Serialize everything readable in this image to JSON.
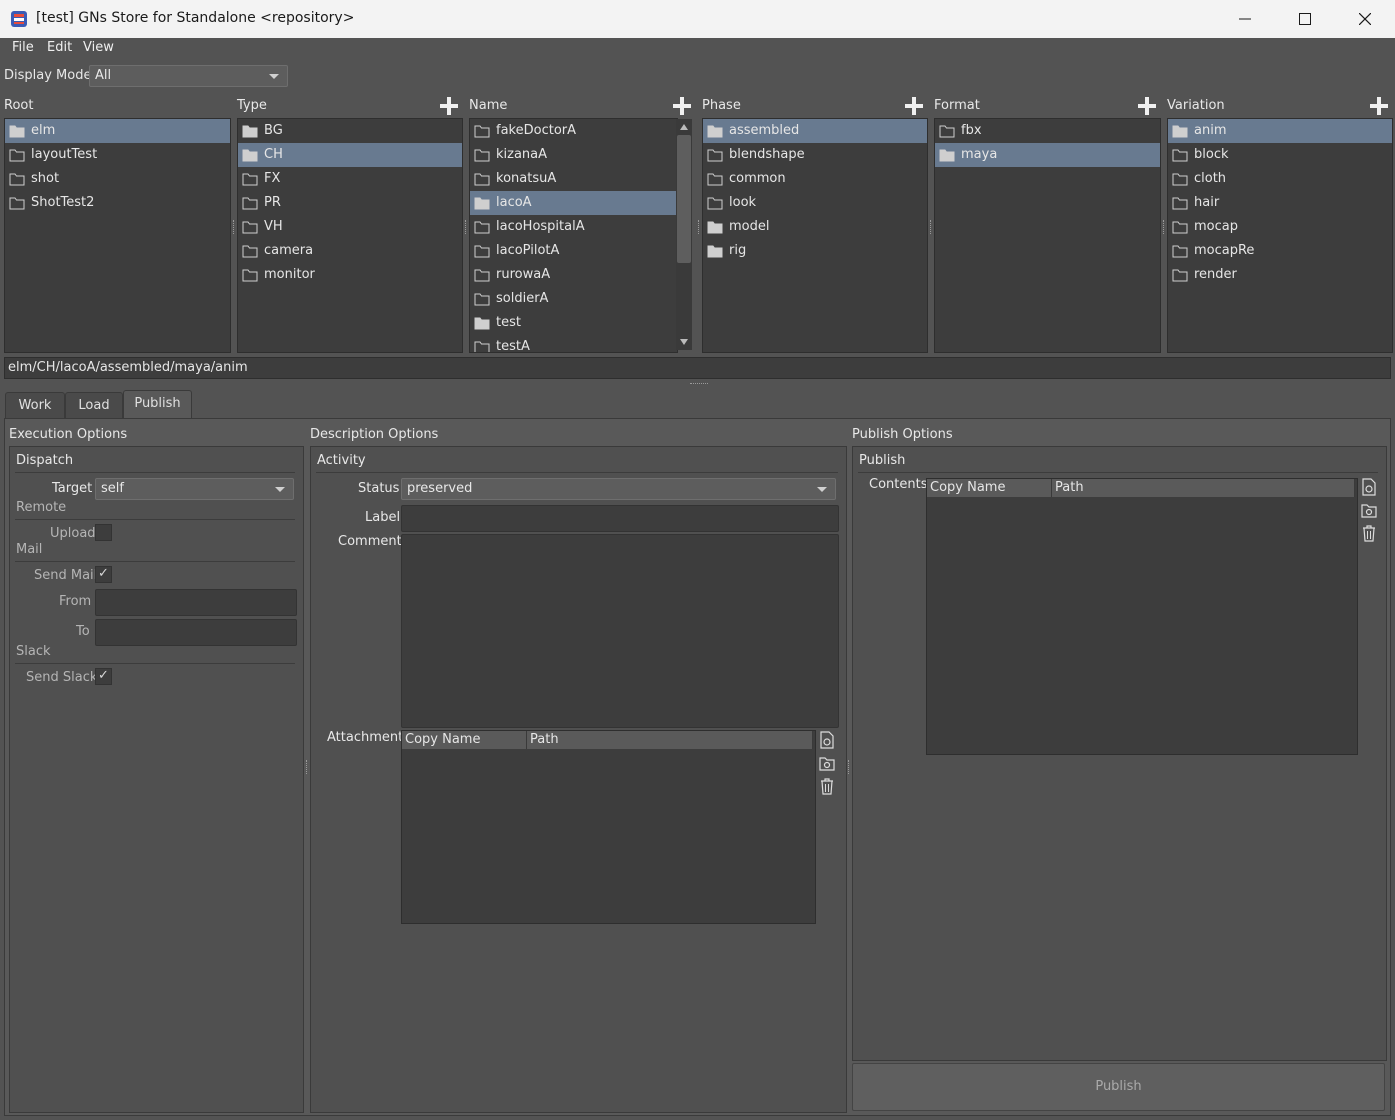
{
  "window": {
    "title": "[test] GNs Store for Standalone <repository>"
  },
  "menu": {
    "items": [
      "File",
      "Edit",
      "View"
    ]
  },
  "display_mode": {
    "label": "Display Mode:",
    "value": "All"
  },
  "columns": {
    "root": {
      "header": "Root",
      "items": [
        "elm",
        "layoutTest",
        "shot",
        "ShotTest2"
      ],
      "selected": "elm"
    },
    "type": {
      "header": "Type",
      "items": [
        "BG",
        "CH",
        "FX",
        "PR",
        "VH",
        "camera",
        "monitor"
      ],
      "selected": "CH"
    },
    "name": {
      "header": "Name",
      "items": [
        "fakeDoctorA",
        "kizanaA",
        "konatsuA",
        "lacoA",
        "lacoHospitalA",
        "lacoPilotA",
        "rurowaA",
        "soldierA",
        "test",
        "testA"
      ],
      "selected": "lacoA"
    },
    "phase": {
      "header": "Phase",
      "items": [
        "assembled",
        "blendshape",
        "common",
        "look",
        "model",
        "rig"
      ],
      "selected": "assembled"
    },
    "format": {
      "header": "Format",
      "items": [
        "fbx",
        "maya"
      ],
      "selected": "maya"
    },
    "variation": {
      "header": "Variation",
      "items": [
        "anim",
        "block",
        "cloth",
        "hair",
        "mocap",
        "mocapRe",
        "render"
      ],
      "selected": "anim"
    }
  },
  "path": "elm/CH/lacoA/assembled/maya/anim",
  "tabs": [
    "Work",
    "Load",
    "Publish"
  ],
  "active_tab": "Publish",
  "execution": {
    "title": "Execution Options",
    "dispatch": "Dispatch",
    "target_label": "Target",
    "target_value": "self",
    "remote": "Remote",
    "upload_label": "Upload",
    "mail": "Mail",
    "send_mail_label": "Send Mail",
    "from_label": "From",
    "to_label": "To",
    "slack": "Slack",
    "send_slack_label": "Send Slack",
    "check_mark": "✓"
  },
  "description": {
    "title": "Description Options",
    "activity": "Activity",
    "status_label": "Status",
    "status_value": "preserved",
    "label_label": "Label",
    "comment_label": "Comment",
    "attachment_label": "Attachment",
    "col_copy_name": "Copy Name",
    "col_path": "Path"
  },
  "publish_options": {
    "title": "Publish Options",
    "publish": "Publish",
    "contents_label": "Contents",
    "col_copy_name": "Copy Name",
    "col_path": "Path",
    "button": "Publish"
  }
}
